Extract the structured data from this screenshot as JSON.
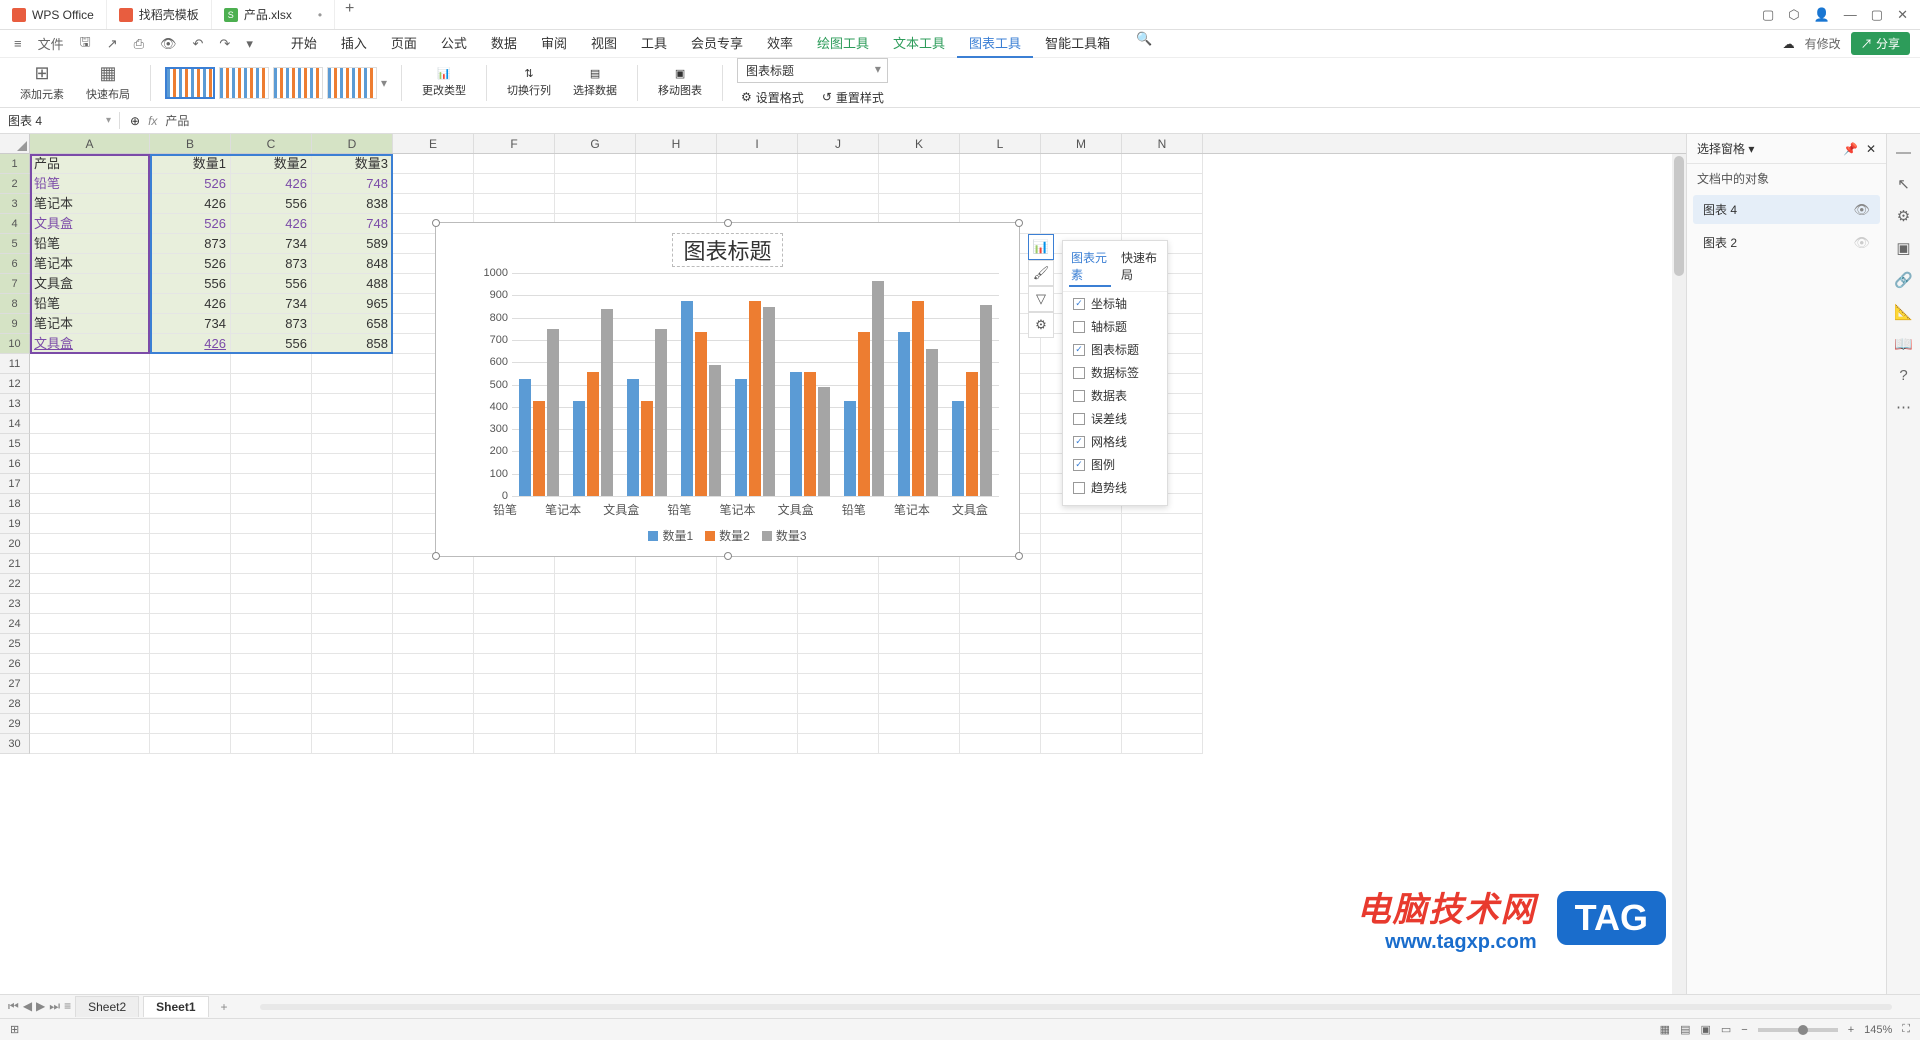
{
  "titlebar": {
    "app_name": "WPS Office",
    "tabs": [
      {
        "label": "找稻壳模板",
        "icon": "red"
      },
      {
        "label": "产品.xlsx",
        "icon": "green",
        "dirty": "•"
      }
    ]
  },
  "menubar": {
    "file": "文件",
    "items": [
      "开始",
      "插入",
      "页面",
      "公式",
      "数据",
      "审阅",
      "视图",
      "工具",
      "会员专享",
      "效率",
      "绘图工具",
      "文本工具",
      "图表工具",
      "智能工具箱"
    ],
    "active_index": 12,
    "cloud": "有修改",
    "share": "分享"
  },
  "ribbon": {
    "add_element": "添加元素",
    "quick_layout": "快速布局",
    "change_type": "更改类型",
    "switch_rc": "切换行列",
    "select_data": "选择数据",
    "move_chart": "移动图表",
    "title_dropdown": "图表标题",
    "set_format": "设置格式",
    "reset_style": "重置样式"
  },
  "formula": {
    "name_box": "图表 4",
    "fx_value": "产品"
  },
  "grid": {
    "cols": [
      "A",
      "B",
      "C",
      "D",
      "E",
      "F",
      "G",
      "H",
      "I",
      "J",
      "K",
      "L",
      "M",
      "N"
    ],
    "header_row": [
      "产品",
      "数量1",
      "数量2",
      "数量3"
    ],
    "rows": [
      [
        "铅笔",
        "526",
        "426",
        "748"
      ],
      [
        "笔记本",
        "426",
        "556",
        "838"
      ],
      [
        "文具盒",
        "526",
        "426",
        "748"
      ],
      [
        "铅笔",
        "873",
        "734",
        "589"
      ],
      [
        "笔记本",
        "526",
        "873",
        "848"
      ],
      [
        "文具盒",
        "556",
        "556",
        "488"
      ],
      [
        "铅笔",
        "426",
        "734",
        "965"
      ],
      [
        "笔记本",
        "734",
        "873",
        "658"
      ],
      [
        "文具盒",
        "426",
        "556",
        "858"
      ]
    ]
  },
  "chart_data": {
    "type": "bar",
    "title": "图表标题",
    "categories": [
      "铅笔",
      "笔记本",
      "文具盒",
      "铅笔",
      "笔记本",
      "文具盒",
      "铅笔",
      "笔记本",
      "文具盒"
    ],
    "series": [
      {
        "name": "数量1",
        "values": [
          526,
          426,
          526,
          873,
          526,
          556,
          426,
          734,
          426
        ]
      },
      {
        "name": "数量2",
        "values": [
          426,
          556,
          426,
          734,
          873,
          556,
          734,
          873,
          556
        ]
      },
      {
        "name": "数量3",
        "values": [
          748,
          838,
          748,
          589,
          848,
          488,
          965,
          658,
          858
        ]
      }
    ],
    "ylim": [
      0,
      1000
    ],
    "yticks": [
      0,
      100,
      200,
      300,
      400,
      500,
      600,
      700,
      800,
      900,
      1000
    ],
    "xlabel": "",
    "ylabel": ""
  },
  "chart_popup": {
    "tab1": "图表元素",
    "tab2": "快速布局",
    "items": [
      {
        "label": "坐标轴",
        "checked": true
      },
      {
        "label": "轴标题",
        "checked": false
      },
      {
        "label": "图表标题",
        "checked": true
      },
      {
        "label": "数据标签",
        "checked": false
      },
      {
        "label": "数据表",
        "checked": false
      },
      {
        "label": "误差线",
        "checked": false
      },
      {
        "label": "网格线",
        "checked": true
      },
      {
        "label": "图例",
        "checked": true
      },
      {
        "label": "趋势线",
        "checked": false
      }
    ]
  },
  "right_panel": {
    "title": "选择窗格",
    "subtitle": "文档中的对象",
    "items": [
      {
        "label": "图表 4",
        "visible": true
      },
      {
        "label": "图表 2",
        "visible": false
      }
    ]
  },
  "sheet_tabs": {
    "tabs": [
      "Sheet2",
      "Sheet1"
    ],
    "active": 1
  },
  "statusbar": {
    "zoom": "145%"
  },
  "watermark": {
    "text": "电脑技术网",
    "url": "www.tagxp.com",
    "tag": "TAG"
  }
}
